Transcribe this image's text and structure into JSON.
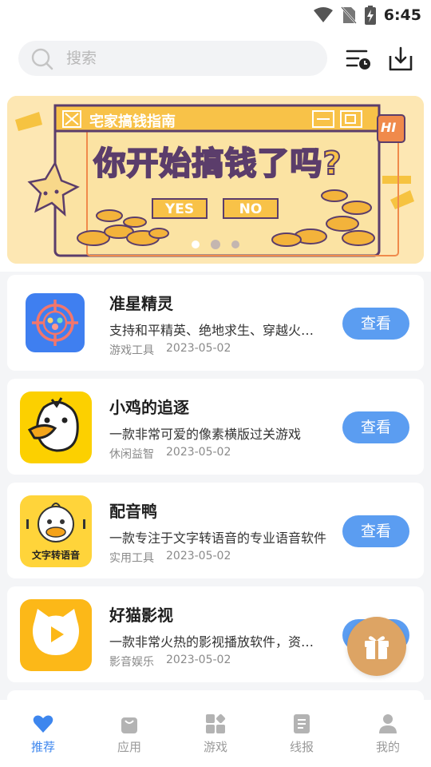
{
  "status_bar": {
    "time": "6:45"
  },
  "search": {
    "placeholder": "搜索"
  },
  "banner": {
    "window_title": "宅家搞钱指南",
    "headline": "你开始搞钱了吗?",
    "yes_label": "YES",
    "no_label": "NO",
    "badge": "HI",
    "page_count": 3,
    "active_page": 1
  },
  "apps": [
    {
      "name": "准星精灵",
      "desc": "支持和平精英、绝地求生、穿越火线等游戏",
      "category": "游戏工具",
      "date": "2023-05-02",
      "button": "查看",
      "icon": "crosshair-icon"
    },
    {
      "name": "小鸡的追逐",
      "desc": "一款非常可爱的像素横版过关游戏",
      "category": "休闲益智",
      "date": "2023-05-02",
      "button": "查看",
      "icon": "chick-icon"
    },
    {
      "name": "配音鸭",
      "desc": "一款专注于文字转语音的专业语音软件",
      "category": "实用工具",
      "date": "2023-05-02",
      "button": "查看",
      "icon": "duck-icon",
      "icon_text": "文字转语音"
    },
    {
      "name": "好猫影视",
      "desc": "一款非常火热的影视播放软件，资源丰富",
      "category": "影音娱乐",
      "date": "2023-05-02",
      "button": "查看",
      "icon": "cat-play-icon"
    }
  ],
  "bottom_nav": [
    {
      "label": "推荐",
      "icon": "heart-icon",
      "active": true
    },
    {
      "label": "应用",
      "icon": "bag-icon",
      "active": false
    },
    {
      "label": "游戏",
      "icon": "blocks-icon",
      "active": false
    },
    {
      "label": "线报",
      "icon": "document-icon",
      "active": false
    },
    {
      "label": "我的",
      "icon": "user-icon",
      "active": false
    }
  ],
  "colors": {
    "accent": "#5b9df1",
    "nav_active": "#3d86ee",
    "gift": "#dda464"
  }
}
